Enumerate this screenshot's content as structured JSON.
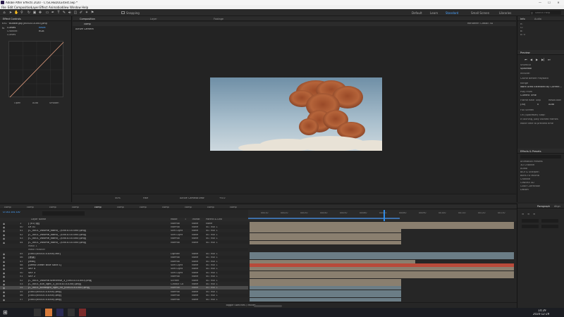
{
  "window": {
    "title": "Adobe After Effects 2020 - C:\\SCHEDULE\\test.aep *",
    "controls": [
      "—",
      "☐",
      "✕"
    ]
  },
  "menu": [
    "File",
    "Edit",
    "Composition",
    "Layer",
    "Effect",
    "Animation",
    "View",
    "Window",
    "Help"
  ],
  "toolbar": {
    "snapping_label": "Snapping",
    "workspaces": [
      "Default",
      "Learn",
      "Standard",
      "Small Screen",
      "Libraries"
    ],
    "search_placeholder": "Search Help"
  },
  "left_panel": {
    "tabs": [
      "Effect Controls"
    ],
    "layer_line": "031 · bubble.jpg [00010-01000].png",
    "effect_name": "Curves",
    "reset_label": "Reset",
    "channel_label": "Channel:",
    "channel_value": "RGB",
    "curves_label": "Curves",
    "curve_buttons": [
      "Open",
      "Auto",
      "Smooth"
    ]
  },
  "viewer": {
    "tabs": [
      "Composition",
      "Layer",
      "Footage"
    ],
    "subtabs": [
      "",
      "comp"
    ],
    "camera_label": "Active Camera",
    "renderer_label": "Renderer: Classic 3D",
    "controls": {
      "zoom": "50%",
      "resolution": "Half",
      "view": "Active Camera",
      "views": "1 View",
      "exposure": "+0.0"
    }
  },
  "right_panel": {
    "info_tab": "Info",
    "audio_tab": "Audio",
    "info_lines": [
      "R:",
      "G:",
      "B:",
      "A: 0"
    ],
    "preview_title": "Preview",
    "preview_lines": [
      "Shortcut",
      "Spacebar",
      "Include:",
      "Cache Before Playback",
      "Range",
      "Work Area Extended By Current...",
      "Play From",
      "Current Time",
      "Frame Rate",
      "Skip",
      "Resolution",
      "(30)",
      "0",
      "Auto",
      "Full Screen",
      "On (Spacebar) Stop:",
      "If caching, play cached frames",
      "Move time to preview time"
    ],
    "effects_title": "Effects & Presets",
    "effects_items": [
      "Animation Presets",
      "3D Channel",
      "Audio",
      "Blur & Sharpen",
      "Boris FX Mocha",
      "Channel",
      "CINEMA 4D",
      "Color Correction",
      "Distort"
    ],
    "paragraph_tab": "Paragraph",
    "align_tab": "Align"
  },
  "timeline": {
    "tabs": [
      "comp",
      "comp",
      "comp",
      "comp",
      "comp",
      "comp",
      "comp",
      "comp",
      "comp",
      "comp",
      "comp"
    ],
    "timecode": "0:00:00:00",
    "headers": [
      "Layer Name",
      "Mode",
      "T",
      "TrkMat",
      "Parent & Link"
    ],
    "ruler_labels": [
      "00010",
      "00020",
      "00030",
      "00040",
      "00050",
      "00060",
      "00070",
      "00080",
      "00090",
      "00100",
      "00110",
      "00120",
      "00130"
    ],
    "rows": [
      {
        "num": "1",
        "name": "[ (01) 组]",
        "mode": "Normal",
        "trk": "None",
        "parent": "None"
      },
      {
        "num": "40",
        "name": "LR 01",
        "mode": "Normal",
        "trk": "None",
        "parent": "40. null 1"
      },
      {
        "num": "41",
        "name": "[C_0001_volume_stand_..(00010-01000).png]",
        "mode": "Soft Light",
        "trk": "None",
        "parent": "40. null 1"
      },
      {
        "num": "42",
        "name": "[C_0001_volume_stand_..(00010-01000).png]",
        "mode": "Soft Light",
        "trk": "None",
        "parent": "40. null 1"
      },
      {
        "num": "43",
        "name": "[C_0001_volume_stand_..(00010-01000).png]",
        "mode": "Normal",
        "trk": "None",
        "parent": "40. null 1"
      },
      {
        "num": "44",
        "name": "[C_0001_volume_stand_..(00010-01000).png]",
        "mode": "Normal",
        "trk": "None",
        "parent": "40. null 1"
      },
      {
        "num": "",
        "name": "Mask 1",
        "mode": "",
        "trk": "",
        "parent": ""
      },
      {
        "num": "",
        "name": "Mask Feather",
        "mode": "",
        "trk": "",
        "parent": ""
      },
      {
        "num": "45",
        "name": "[0001(00010-01000).exr]",
        "mode": "Lighten",
        "trk": "None",
        "parent": "40. null 1"
      },
      {
        "num": "46",
        "name": "[遮罩]",
        "mode": "Normal",
        "trk": "None",
        "parent": "40. null 1"
      },
      {
        "num": "47",
        "name": "[Mist]",
        "mode": "Normal",
        "trk": "None",
        "parent": "40. null 1"
      },
      {
        "num": "48",
        "name": "[Deep Ocean Blue Solid 1]",
        "mode": "Soft Light",
        "trk": "None",
        "parent": "40. null 1"
      },
      {
        "num": "49",
        "name": "SKY 4",
        "mode": "Soft Light",
        "trk": "None",
        "parent": "40. null 1"
      },
      {
        "num": "50",
        "name": "SKY 3",
        "mode": "Soft Light",
        "trk": "None",
        "parent": "40. null 1"
      },
      {
        "num": "51",
        "name": "SKY 2",
        "mode": "Normal",
        "trk": "None",
        "parent": "40. null 1"
      },
      {
        "num": "52",
        "name": "[C_0001_volume.scenerise_3_(00010-01000).png]",
        "mode": "Screen",
        "trk": "None",
        "parent": "40. null 1"
      },
      {
        "num": "53",
        "name": "[C_0001_sun_light_3_(00010-01000).png]",
        "mode": "Classic Co",
        "trk": "None",
        "parent": "40. null 1"
      },
      {
        "num": "54",
        "name": "[C_0001_solidlight_light_50_(00010-01000).png]",
        "mode": "Normal",
        "trk": "None",
        "parent": "40. null 1"
      },
      {
        "num": "55",
        "name": "[0001(00010-01000).png]",
        "mode": "Normal",
        "trk": "None",
        "parent": "40. null 1"
      },
      {
        "num": "56",
        "name": "[0001(00010-01000).png]",
        "mode": "Normal",
        "trk": "None",
        "parent": "40. null 1"
      },
      {
        "num": "57",
        "name": "[0001(00010-01000).png]",
        "mode": "Normal",
        "trk": "None",
        "parent": "40. null 1"
      }
    ],
    "toggle_label": "Toggle Switches / Modes"
  },
  "taskbar": {
    "time": "14:29",
    "date": "2020-12-29"
  },
  "colors": {
    "accent": "#2d8ceb",
    "layer_bar": "#8a7f6f",
    "layer_bar_alt": "#6b7d86",
    "layer_bar_red": "#b84a3a",
    "selected_row": "#4a4a4a"
  }
}
